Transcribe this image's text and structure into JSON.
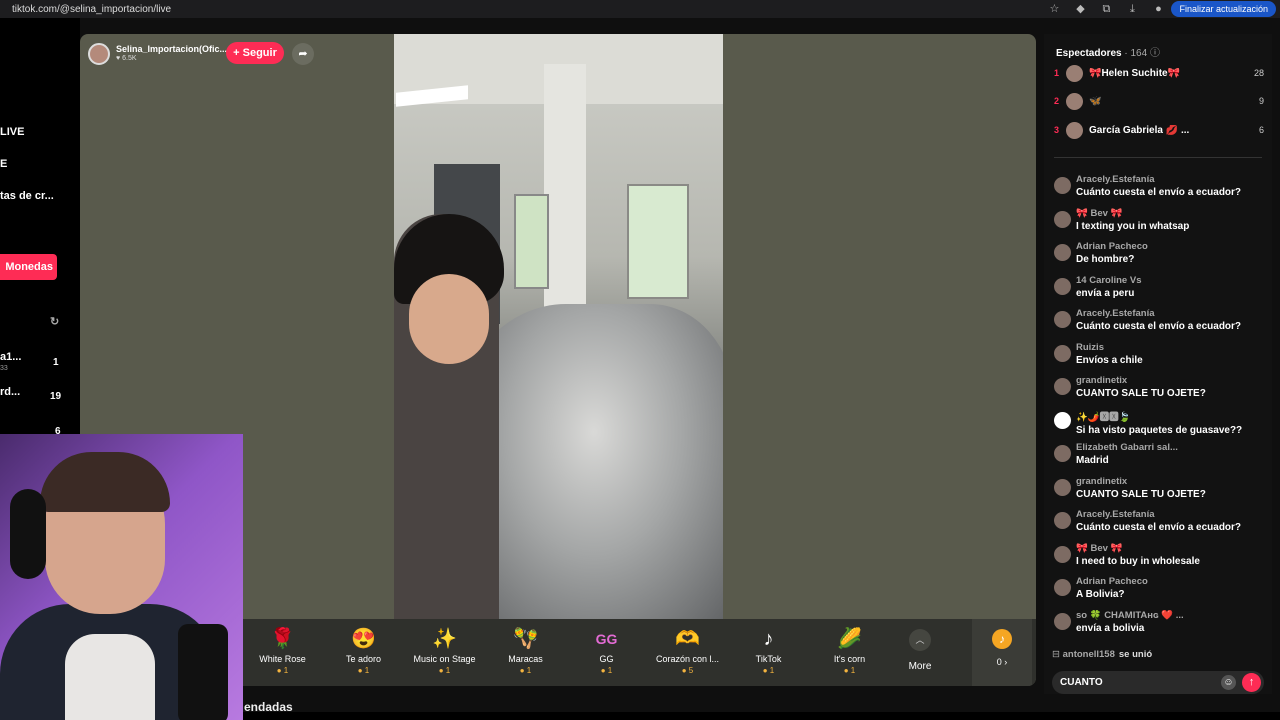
{
  "browser": {
    "url": "tiktok.com/@selina_importacion/live",
    "update_label": "Finalizar actualización"
  },
  "leftnav": {
    "items": [
      "LIVE",
      "E",
      "tas de cr...",
      "a1...",
      "rd..."
    ],
    "sub": "33",
    "counts": [
      "1",
      "19",
      "6"
    ],
    "coins_label": "Monedas"
  },
  "stream": {
    "host_name": "Selina_Importacion(Ofic...",
    "host_likes": "6.5K",
    "follow_label": "+ Seguir"
  },
  "gifts": [
    {
      "name": "White Rose",
      "cost": "1",
      "icon": "rose-icon"
    },
    {
      "name": "Te adoro",
      "cost": "1",
      "icon": "heart-face-icon"
    },
    {
      "name": "Music on Stage",
      "cost": "1",
      "icon": "star-icon"
    },
    {
      "name": "Maracas",
      "cost": "1",
      "icon": "maracas-icon"
    },
    {
      "name": "GG",
      "cost": "1",
      "icon": "gg-icon"
    },
    {
      "name": "Corazón con l...",
      "cost": "5",
      "icon": "hand-heart-icon"
    },
    {
      "name": "TikTok",
      "cost": "1",
      "icon": "tiktok-icon"
    },
    {
      "name": "It's corn",
      "cost": "1",
      "icon": "corn-icon"
    }
  ],
  "more_label": "More",
  "coin_balance": "0 ›",
  "bottom_heading": "endadas",
  "viewers": {
    "title": "Espectadores",
    "count": "· 164",
    "top": [
      {
        "rank": "1",
        "name": "🎀Helen Suchite🎀",
        "score": "28"
      },
      {
        "rank": "2",
        "name": "🦋",
        "score": "9"
      },
      {
        "rank": "3",
        "name": "García Gabriela 💋 ...",
        "score": "6"
      }
    ]
  },
  "chat": [
    {
      "user": "Aracely.Estefanía",
      "text": "Cuánto cuesta el envío a ecuador?"
    },
    {
      "user": "🎀 Bev 🎀",
      "text": "I texting you in whatsap"
    },
    {
      "user": "Adrian Pacheco",
      "text": "De hombre?"
    },
    {
      "user": "14 Caroline Vs",
      "text": "envía a peru"
    },
    {
      "user": "Aracely.Estefanía",
      "text": "Cuánto cuesta el envío a ecuador?"
    },
    {
      "user": "Ruizis",
      "text": "Envíos a chile"
    },
    {
      "user": "grandinetix",
      "text": "CUANTO SALE TU OJETE?"
    },
    {
      "user": "✨🌶️🆇🆇🍃",
      "text": "Si ha visto paquetes de guasave??"
    },
    {
      "user": "Elizabeth Gabarri sal...",
      "text": "Madrid"
    },
    {
      "user": "grandinetix",
      "text": "CUANTO SALE TU OJETE?"
    },
    {
      "user": "Aracely.Estefanía",
      "text": "Cuánto cuesta el envío a ecuador?"
    },
    {
      "user": "🎀 Bev 🎀",
      "text": "I need to buy in wholesale"
    },
    {
      "user": "Adrian Pacheco",
      "text": "A Bolivia?"
    },
    {
      "user": "so 🍀 CHAMITAʜɢ ❤️ ...",
      "text": "envía a bolivia"
    }
  ],
  "joined": {
    "user": "antonell158",
    "label": "se unió"
  },
  "comment_input": {
    "value": "CUANTO"
  }
}
